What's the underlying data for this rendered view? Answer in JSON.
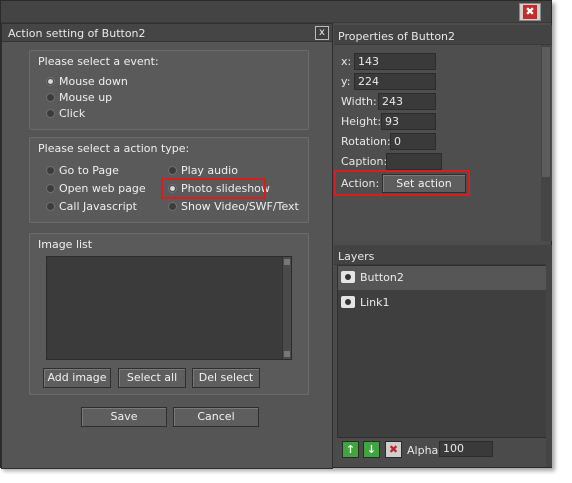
{
  "app": {
    "close_glyph": "✖"
  },
  "dialog": {
    "title": "Action setting of Button2",
    "close_glyph": "x",
    "event_group": {
      "title": "Please select a event:",
      "options": [
        "Mouse down",
        "Mouse up",
        "Click"
      ],
      "selected_index": 0
    },
    "action_group": {
      "title": "Please select a action type:",
      "options_left": [
        "Go to Page",
        "Open web page",
        "Call Javascript"
      ],
      "options_right": [
        "Play audio",
        "Photo slideshow",
        "Show Video/SWF/Text"
      ],
      "selected": "Photo slideshow"
    },
    "image_list": {
      "title": "Image list",
      "add_label": "Add image",
      "select_all_label": "Select all",
      "del_label": "Del select"
    },
    "save_label": "Save",
    "cancel_label": "Cancel"
  },
  "properties": {
    "title": "Properties of Button2",
    "x_label": "x:",
    "x_value": "143",
    "y_label": "y:",
    "y_value": "224",
    "width_label": "Width:",
    "width_value": "243",
    "height_label": "Height:",
    "height_value": "93",
    "rotation_label": "Rotation:",
    "rotation_value": "0",
    "caption_label": "Caption:",
    "caption_value": "",
    "action_label": "Action:",
    "set_action_label": "Set action"
  },
  "layers": {
    "title": "Layers",
    "items": [
      {
        "name": "Button2",
        "selected": true
      },
      {
        "name": "Link1",
        "selected": false
      }
    ],
    "up_glyph": "↑",
    "down_glyph": "↓",
    "delete_glyph": "✖",
    "alpha_label": "Alpha:",
    "alpha_value": "100"
  },
  "colors": {
    "highlight": "#d91c1c",
    "panel": "#4e4e4e",
    "dialog": "#555555"
  },
  "icons": [
    "close-icon",
    "eye-icon",
    "arrow-up-icon",
    "arrow-down-icon",
    "delete-icon"
  ]
}
